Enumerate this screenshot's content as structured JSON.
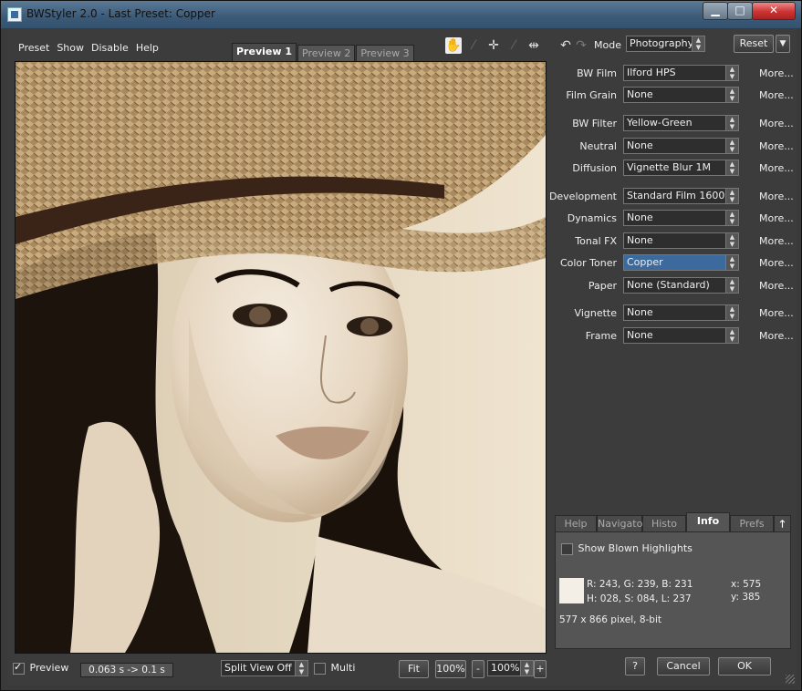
{
  "window": {
    "title": "BWStyler 2.0 - Last Preset: Copper",
    "min": "▁",
    "max": "□",
    "close": "✕"
  },
  "menu": [
    "Preset",
    "Show",
    "Disable",
    "Help"
  ],
  "preview_tabs": [
    "Preview 1",
    "Preview 2",
    "Preview 3"
  ],
  "tool_icons": [
    "hand-icon",
    "dropper-icon",
    "crosshair-icon",
    "pencil-icon",
    "split-arrows-icon"
  ],
  "mode": {
    "label": "Mode",
    "value": "Photography Mod",
    "reset": "Reset",
    "undo": "↶",
    "redo": "↷"
  },
  "params": [
    {
      "label": "BW Film",
      "value": "Ilford HPS",
      "more": "More..."
    },
    {
      "label": "Film Grain",
      "value": "None",
      "more": "More..."
    },
    {
      "label": "BW Filter",
      "value": "Yellow-Green",
      "more": "More..."
    },
    {
      "label": "Neutral",
      "value": "None",
      "more": "More..."
    },
    {
      "label": "Diffusion",
      "value": "Vignette Blur 1M",
      "more": "More..."
    },
    {
      "label": "Development",
      "value": "Standard Film 1600",
      "more": "More..."
    },
    {
      "label": "Dynamics",
      "value": "None",
      "more": "More..."
    },
    {
      "label": "Tonal FX",
      "value": "None",
      "more": "More..."
    },
    {
      "label": "Color Toner",
      "value": "Copper",
      "more": "More..."
    },
    {
      "label": "Paper",
      "value": "None (Standard)",
      "more": "More..."
    },
    {
      "label": "Vignette",
      "value": "None",
      "more": "More..."
    },
    {
      "label": "Frame",
      "value": "None",
      "more": "More..."
    }
  ],
  "panel_tabs": [
    "Help",
    "Navigator",
    "Histo",
    "Info",
    "Prefs"
  ],
  "info": {
    "show_blown": "Show Blown Highlights",
    "rgb": "R: 243, G: 239, B: 231",
    "hsl": "H: 028, S: 084, L: 237",
    "x": "x: 575",
    "y": "y: 385",
    "size": "577 x 866 pixel, 8-bit",
    "swatch_color": "#f3efe7"
  },
  "bottom": {
    "preview_label": "Preview",
    "timing": "0.063 s -> 0.1 s",
    "split_view": "Split View Off",
    "multi": "Multi",
    "fit": "Fit",
    "zoom1": "100%",
    "minus": "-",
    "zoom2": "100%",
    "plus": "+",
    "help": "?",
    "cancel": "Cancel",
    "ok": "OK"
  },
  "accent": "#3d6a9c"
}
